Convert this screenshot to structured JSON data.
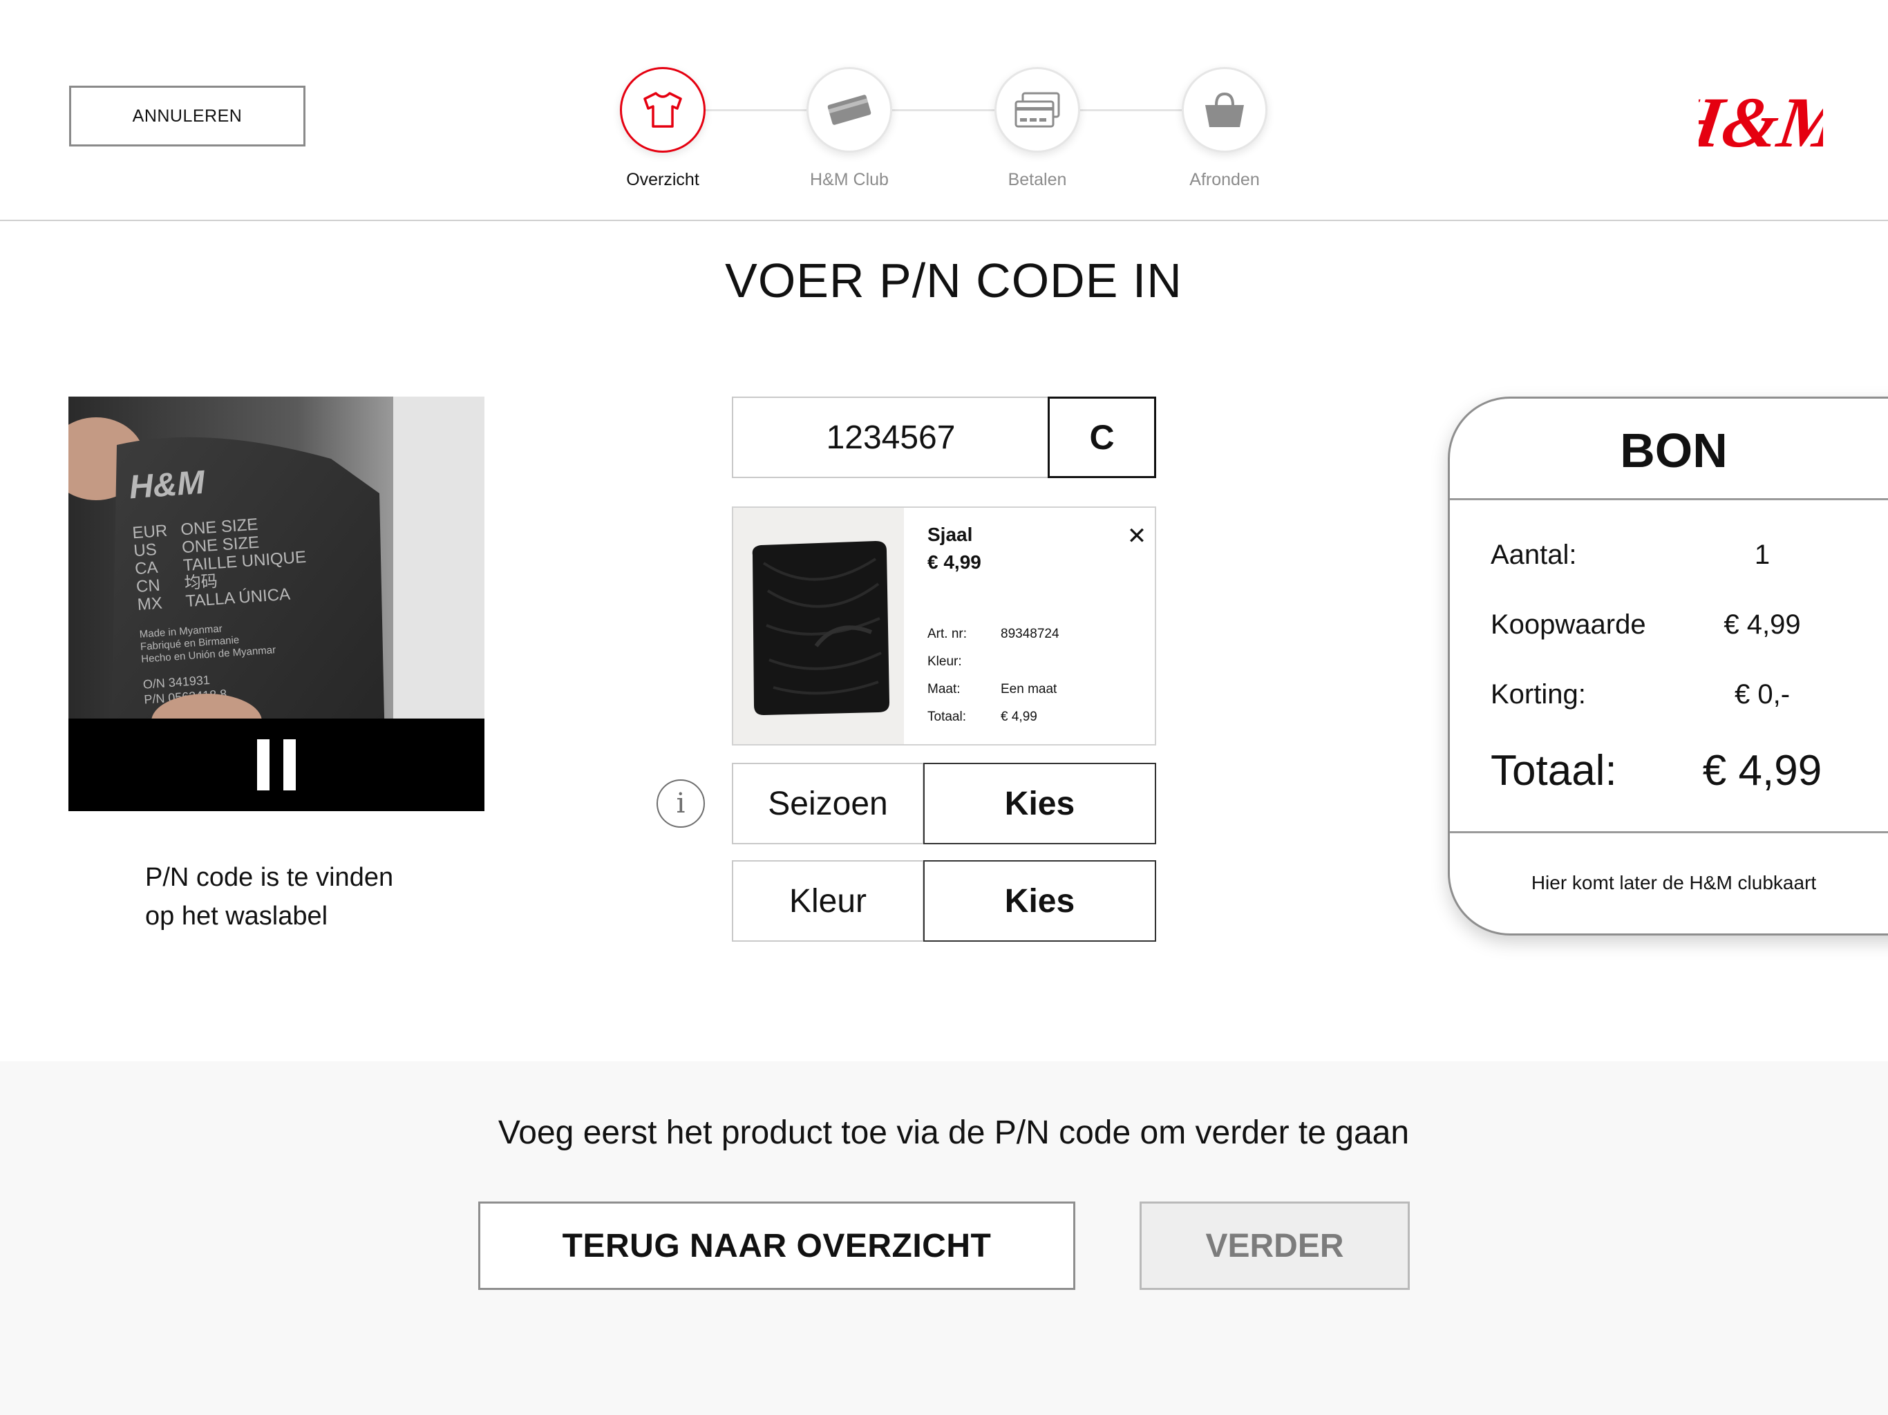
{
  "header": {
    "cancel_label": "ANNULEREN",
    "logo_text": "H&M",
    "steps": [
      {
        "label": "Overzicht",
        "icon": "tshirt-icon",
        "active": true
      },
      {
        "label": "H&M Club",
        "icon": "club-card-icon",
        "active": false
      },
      {
        "label": "Betalen",
        "icon": "payment-cards-icon",
        "active": false
      },
      {
        "label": "Afronden",
        "icon": "shopping-bag-icon",
        "active": false
      }
    ]
  },
  "page": {
    "title": "VOER P/N CODE IN"
  },
  "video": {
    "label": {
      "brand": "H&M",
      "sizes": [
        [
          "EUR",
          "ONE SIZE"
        ],
        [
          "US",
          "ONE SIZE"
        ],
        [
          "CA",
          "TAILLE UNIQUE"
        ],
        [
          "CN",
          "均码"
        ],
        [
          "MX",
          "TALLA ÚNICA"
        ]
      ],
      "made_in": [
        "Made in Myanmar",
        "Fabriqué en Birmanie",
        "Hecho en Unión de Myanmar"
      ],
      "codes": [
        "O/N 341931",
        "P/N 0563418 8"
      ]
    },
    "pause_icon": "pause-icon"
  },
  "hint": {
    "line1": "P/N code is te vinden",
    "line2": "op het waslabel"
  },
  "code_entry": {
    "value": "1234567",
    "clear_label": "C"
  },
  "product": {
    "name": "Sjaal",
    "price": "€ 4,99",
    "close_icon": "close-icon",
    "specs": [
      {
        "label": "Art. nr:",
        "value": "89348724"
      },
      {
        "label": "Kleur:",
        "value": ""
      },
      {
        "label": "Maat:",
        "value": "Een maat"
      },
      {
        "label": "Totaal:",
        "value": "€ 4,99"
      }
    ]
  },
  "selectors": [
    {
      "label": "Seizoen",
      "button": "Kies"
    },
    {
      "label": "Kleur",
      "button": "Kies"
    }
  ],
  "info_glyph": "i",
  "receipt": {
    "title": "BON",
    "rows": [
      {
        "label": "Aantal:",
        "value": "1"
      },
      {
        "label": "Koopwaarde",
        "value": "€ 4,99"
      },
      {
        "label": "Korting:",
        "value": "€ 0,-"
      }
    ],
    "total_label": "Totaal:",
    "total_value": "€ 4,99",
    "footer": "Hier komt later de H&M clubkaart"
  },
  "footer": {
    "message": "Voeg eerst het product toe via de P/N code om verder te gaan",
    "back_label": "TERUG NAAR OVERZICHT",
    "next_label": "VERDER"
  },
  "colors": {
    "brand_red": "#e50010",
    "disabled_gray": "#7c7c7c"
  }
}
